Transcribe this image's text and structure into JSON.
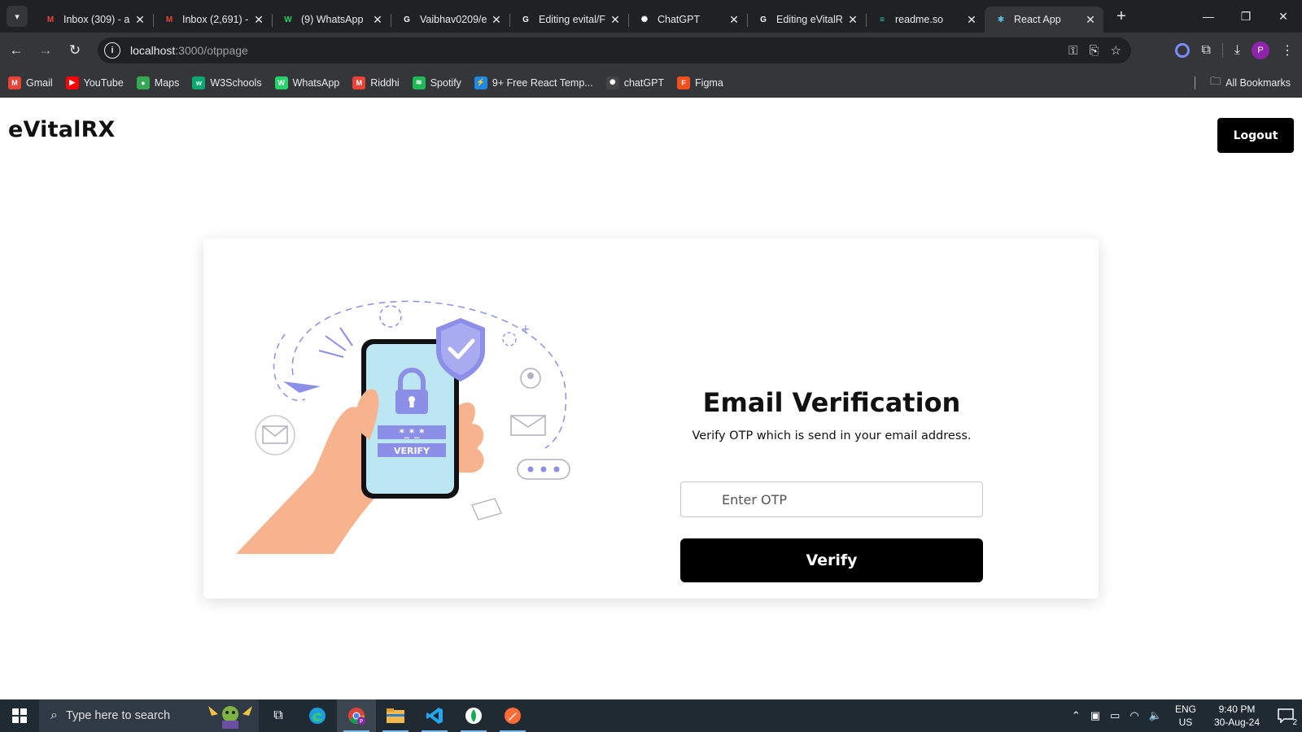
{
  "browser": {
    "tabs": [
      {
        "title": "Inbox (309) - a",
        "icon": "gmail-icon",
        "color": "#ea4335",
        "glyph": "M"
      },
      {
        "title": "Inbox (2,691) -",
        "icon": "gmail-icon",
        "color": "#ea4335",
        "glyph": "M"
      },
      {
        "title": "(9) WhatsApp",
        "icon": "whatsapp-icon",
        "color": "#25d366",
        "glyph": "W"
      },
      {
        "title": "Vaibhav0209/e",
        "icon": "github-icon",
        "color": "#ffffff",
        "glyph": "G"
      },
      {
        "title": "Editing evital/F",
        "icon": "github-icon",
        "color": "#ffffff",
        "glyph": "G"
      },
      {
        "title": "ChatGPT",
        "icon": "chatgpt-icon",
        "color": "#ffffff",
        "glyph": "✺"
      },
      {
        "title": "Editing eVitalR",
        "icon": "github-icon",
        "color": "#ffffff",
        "glyph": "G"
      },
      {
        "title": "readme.so",
        "icon": "readme-icon",
        "color": "#2dd4bf",
        "glyph": "≡"
      },
      {
        "title": "React App",
        "icon": "react-icon",
        "color": "#61dafb",
        "glyph": "⚛"
      }
    ],
    "active_tab": 8,
    "url_host": "localhost",
    "url_path": ":3000/otppage",
    "bookmarks": [
      {
        "label": "Gmail",
        "icon": "gmail-icon",
        "color": "#ea4335",
        "glyph": "M"
      },
      {
        "label": "YouTube",
        "icon": "youtube-icon",
        "color": "#ff0000",
        "glyph": "▶"
      },
      {
        "label": "Maps",
        "icon": "maps-icon",
        "color": "#34a853",
        "glyph": "●"
      },
      {
        "label": "W3Schools",
        "icon": "w3schools-icon",
        "color": "#04aa6d",
        "glyph": "w"
      },
      {
        "label": "WhatsApp",
        "icon": "whatsapp-icon",
        "color": "#25d366",
        "glyph": "W"
      },
      {
        "label": "Riddhi",
        "icon": "gmail-icon",
        "color": "#ea4335",
        "glyph": "M"
      },
      {
        "label": "Spotify",
        "icon": "spotify-icon",
        "color": "#1db954",
        "glyph": "≋"
      },
      {
        "label": "9+ Free React Temp...",
        "icon": "template-icon",
        "color": "#1e88e5",
        "glyph": "⚡"
      },
      {
        "label": "chatGPT",
        "icon": "chatgpt-icon",
        "color": "#444444",
        "glyph": "✺"
      },
      {
        "label": "Figma",
        "icon": "figma-icon",
        "color": "#f24e1e",
        "glyph": "F"
      }
    ],
    "all_bookmarks": "All Bookmarks",
    "avatar_letter": "P"
  },
  "page": {
    "brand": "eVitalRX",
    "logout_label": "Logout",
    "title": "Email Verification",
    "subtitle": "Verify OTP which is send in your email address.",
    "otp_placeholder": "Enter OTP",
    "otp_value": "",
    "verify_label": "Verify",
    "illustration": {
      "code_text": "*_*_*",
      "verify_text": "VERIFY"
    }
  },
  "taskbar": {
    "search_placeholder": "Type here to search",
    "lang_top": "ENG",
    "lang_bottom": "US",
    "time": "9:40 PM",
    "date": "30-Aug-24",
    "notification_count": "2"
  },
  "colors": {
    "primary_button": "#000000",
    "illustration_purple": "#8c8fe8",
    "phone_screen": "#bde6f3",
    "hand": "#f6b38e"
  }
}
